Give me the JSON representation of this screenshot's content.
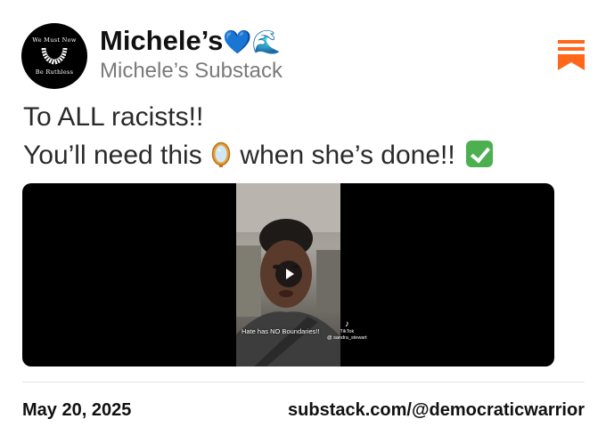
{
  "header": {
    "author_name": "Michele’s",
    "author_emoji": "💙🌊",
    "publication_name": "Michele’s Substack",
    "avatar": {
      "top_text": "We Must Now",
      "bottom_text": "Be Ruthless",
      "icon": "collar-icon"
    },
    "logo_icon": "substack-logo-icon",
    "brand_color": "#ff6719"
  },
  "post": {
    "line1": "To ALL racists!!",
    "line2_before": "You’ll need this",
    "line2_after": "when she’s done!!",
    "mirror_icon": "mirror-emoji-icon",
    "check_icon": "check-mark-emoji-icon"
  },
  "video": {
    "overlay_text": "Hate has NO Boundaries!!",
    "tiktok_label": "TikTok",
    "tiktok_handle": "@ sandra_stewart",
    "play_icon": "play-icon"
  },
  "footer": {
    "date": "May 20, 2025",
    "url": "substack.com/@democraticwarrior"
  }
}
